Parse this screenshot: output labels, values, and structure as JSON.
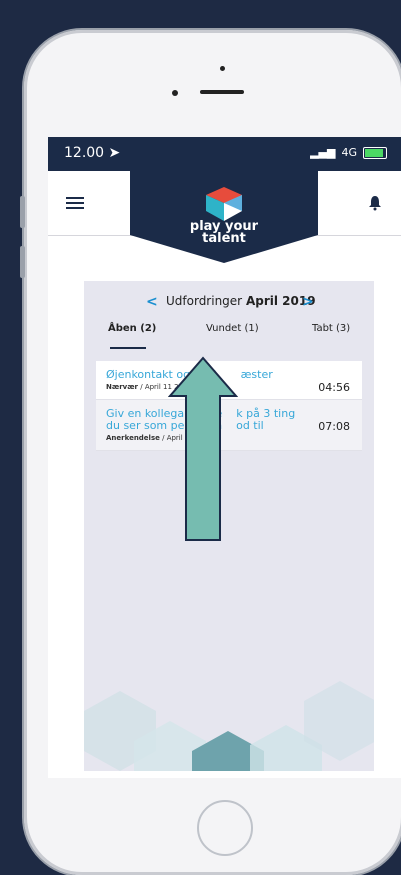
{
  "status": {
    "time": "12.00",
    "network": "4G"
  },
  "app": {
    "logo_line1": "play your",
    "logo_line2": "talent"
  },
  "header": {
    "prefix": "Udfordringer",
    "month": "April 2019"
  },
  "tabs": [
    {
      "label": "Åben (2)"
    },
    {
      "label": "Vundet (1)"
    },
    {
      "label": "Tabt (3)"
    }
  ],
  "items": [
    {
      "title": "Øjenkontakt og smil",
      "title_tail": "æster",
      "category": "Nærvær",
      "date": "April 11 2019",
      "time": "04:56"
    },
    {
      "title": "Giv en kollega en fee",
      "title_tail": "k på 3 ting",
      "title_line2": "du ser som personen",
      "title_line2_tail": "od til",
      "category": "Anerkendelse",
      "date": "April 11 20",
      "time": "07:08"
    }
  ],
  "colors": {
    "navy": "#1b2b48",
    "accent": "#37a7d8",
    "arrow_fill": "#76bcb0",
    "arrow_stroke": "#1b2b48"
  }
}
